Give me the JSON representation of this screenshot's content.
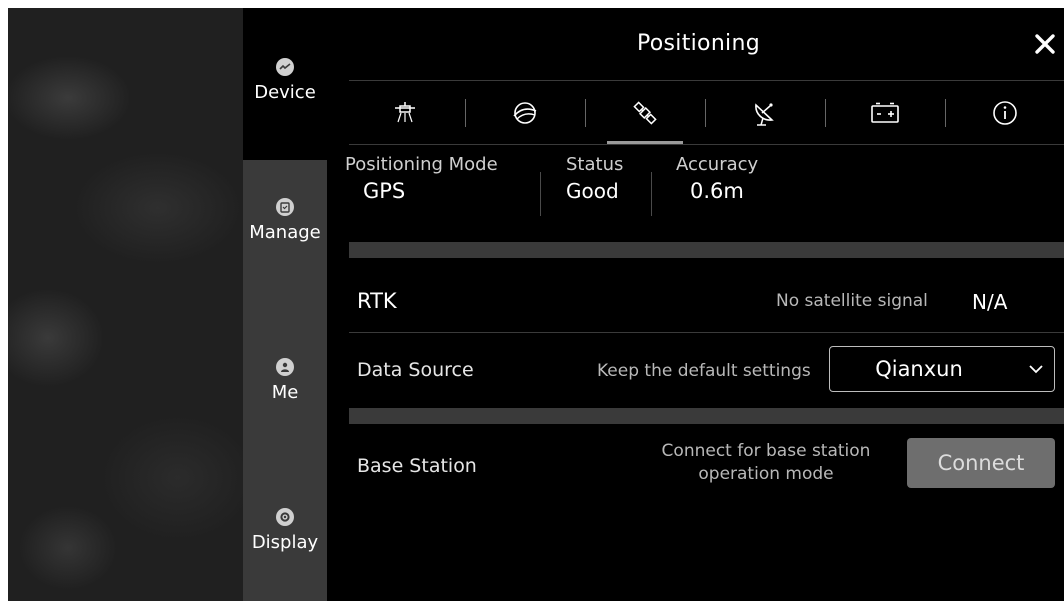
{
  "sidebar": {
    "items": [
      {
        "label": "Device",
        "icon": "drone-icon"
      },
      {
        "label": "Manage",
        "icon": "clipboard-icon"
      },
      {
        "label": "Me",
        "icon": "user-icon"
      },
      {
        "label": "Display",
        "icon": "settings-icon"
      }
    ]
  },
  "header": {
    "title": "Positioning"
  },
  "tabs": [
    "drone-rtk-icon",
    "gimbal-icon",
    "satellite-icon",
    "satellite-dish-icon",
    "battery-icon",
    "info-icon"
  ],
  "stats": {
    "mode_label": "Positioning Mode",
    "mode_value": "GPS",
    "status_label": "Status",
    "status_value": "Good",
    "accuracy_label": "Accuracy",
    "accuracy_value": "0.6m"
  },
  "rtk": {
    "title": "RTK",
    "signal_text": "No satellite signal",
    "signal_value": "N/A"
  },
  "data_source": {
    "label": "Data Source",
    "hint": "Keep the default settings",
    "selected": "Qianxun"
  },
  "base_station": {
    "label": "Base Station",
    "hint_line1": "Connect for base station",
    "hint_line2": "operation mode",
    "button": "Connect"
  },
  "colors": {
    "background": "#000000",
    "sidebar": "#3a3a3a",
    "band": "#3a3a3a",
    "button": "#6e6e6e"
  }
}
